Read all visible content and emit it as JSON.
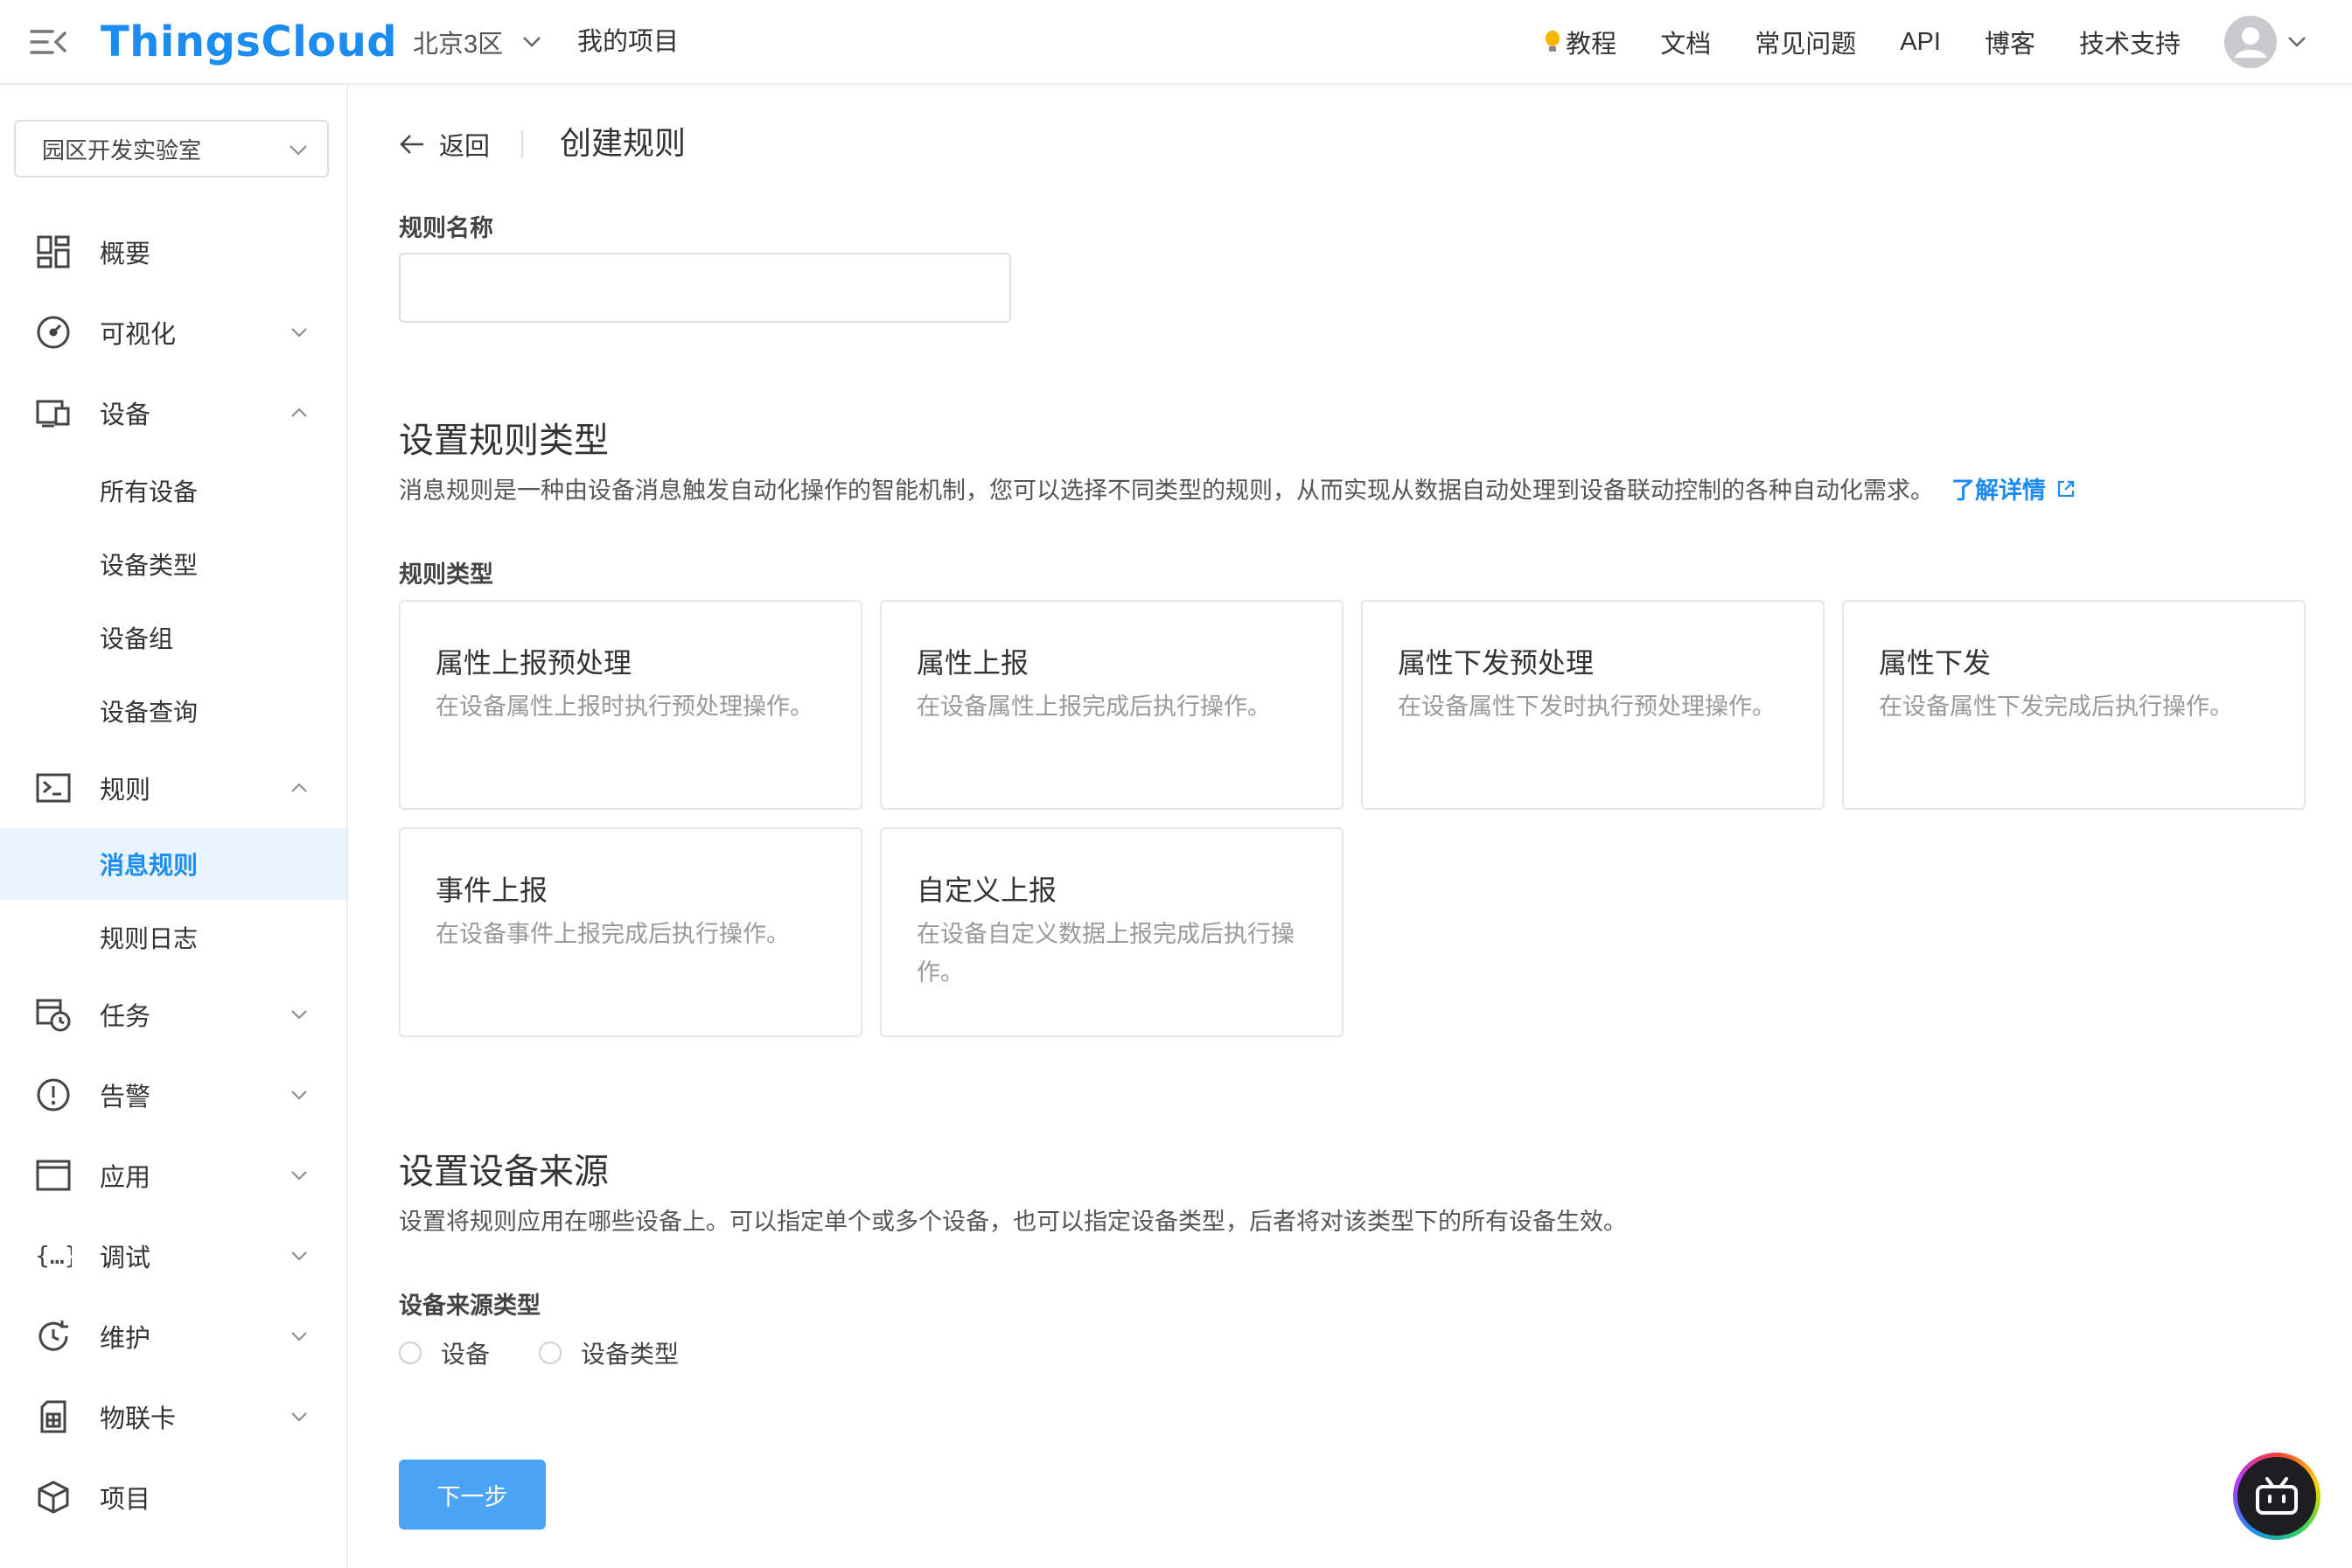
{
  "brand": {
    "logo": "ThingsCloud",
    "accent": "#1d8cf0"
  },
  "header": {
    "region": "北京3区",
    "my_project": "我的项目",
    "nav": [
      "教程",
      "文档",
      "常见问题",
      "API",
      "博客",
      "技术支持"
    ]
  },
  "sidebar": {
    "project": "园区开发实验室",
    "items": {
      "overview": "概要",
      "visual": "可视化",
      "device": "设备",
      "all_devices": "所有设备",
      "device_types": "设备类型",
      "device_groups": "设备组",
      "device_query": "设备查询",
      "rules": "规则",
      "message_rules": "消息规则",
      "rule_logs": "规则日志",
      "tasks": "任务",
      "alarms": "告警",
      "apps": "应用",
      "debug": "调试",
      "maintenance": "维护",
      "iot_card": "物联卡",
      "project": "项目"
    }
  },
  "page": {
    "back": "返回",
    "title": "创建规则",
    "rule_name_label": "规则名称",
    "rule_name_value": "",
    "rule_type_section": {
      "title": "设置规则类型",
      "desc": "消息规则是一种由设备消息触发自动化操作的智能机制，您可以选择不同类型的规则，从而实现从数据自动处理到设备联动控制的各种自动化需求。",
      "learn_more": "了解详情",
      "label": "规则类型",
      "cards": [
        {
          "title": "属性上报预处理",
          "desc": "在设备属性上报时执行预处理操作。"
        },
        {
          "title": "属性上报",
          "desc": "在设备属性上报完成后执行操作。"
        },
        {
          "title": "属性下发预处理",
          "desc": "在设备属性下发时执行预处理操作。"
        },
        {
          "title": "属性下发",
          "desc": "在设备属性下发完成后执行操作。"
        },
        {
          "title": "事件上报",
          "desc": "在设备事件上报完成后执行操作。"
        },
        {
          "title": "自定义上报",
          "desc": "在设备自定义数据上报完成后执行操作。"
        }
      ]
    },
    "source_section": {
      "title": "设置设备来源",
      "desc": "设置将规则应用在哪些设备上。可以指定单个或多个设备，也可以指定设备类型，后者将对该类型下的所有设备生效。",
      "label": "设备来源类型",
      "options": [
        "设备",
        "设备类型"
      ]
    },
    "next_button": "下一步"
  }
}
